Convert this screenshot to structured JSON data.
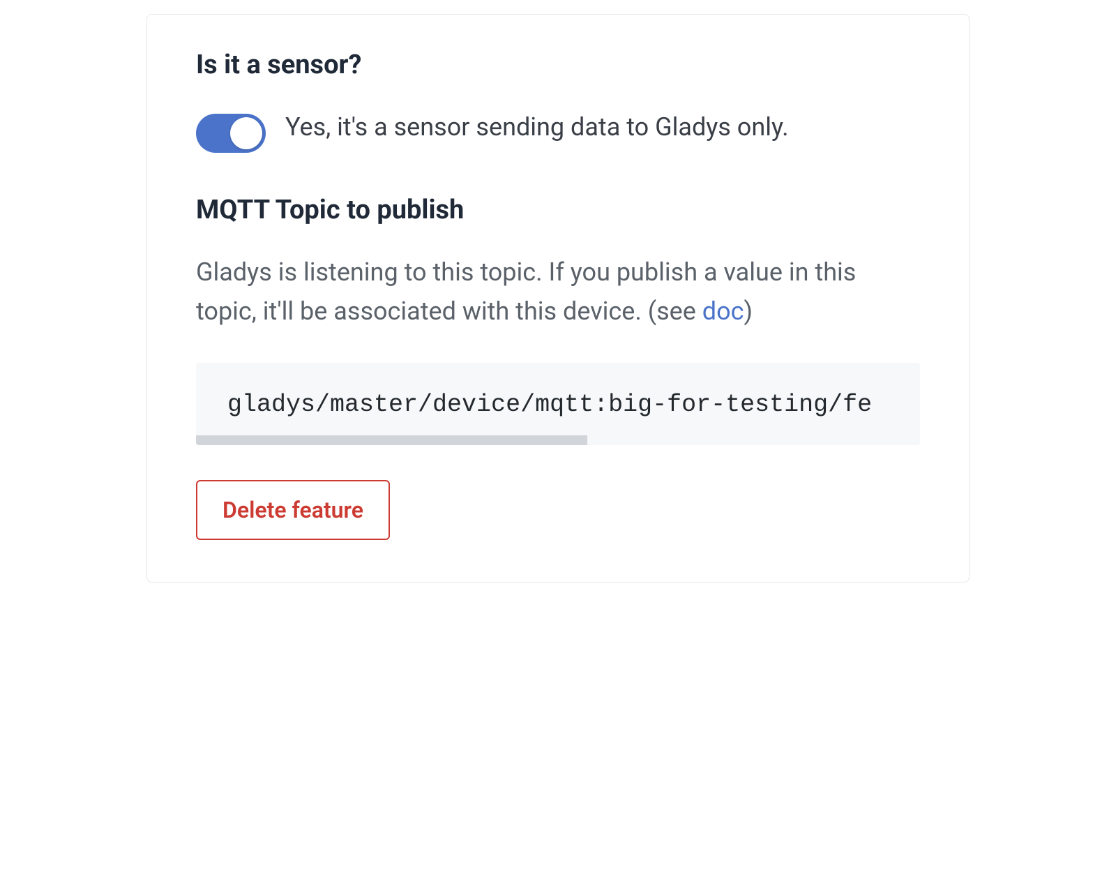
{
  "sensor_section": {
    "heading": "Is it a sensor?",
    "toggle_on": true,
    "toggle_label": "Yes, it's a sensor sending data to Gladys only."
  },
  "mqtt_section": {
    "heading": "MQTT Topic to publish",
    "description_pre": "Gladys is listening to this topic. If you publish a value in this topic, it'll be associated with this device. (see ",
    "doc_link_text": "doc",
    "description_post": ")",
    "topic_value": "gladys/master/device/mqtt:big-for-testing/fe"
  },
  "actions": {
    "delete_label": "Delete feature"
  },
  "colors": {
    "accent": "#4a73c9",
    "danger": "#cc3b32",
    "code_bg": "#f6f8fa"
  }
}
